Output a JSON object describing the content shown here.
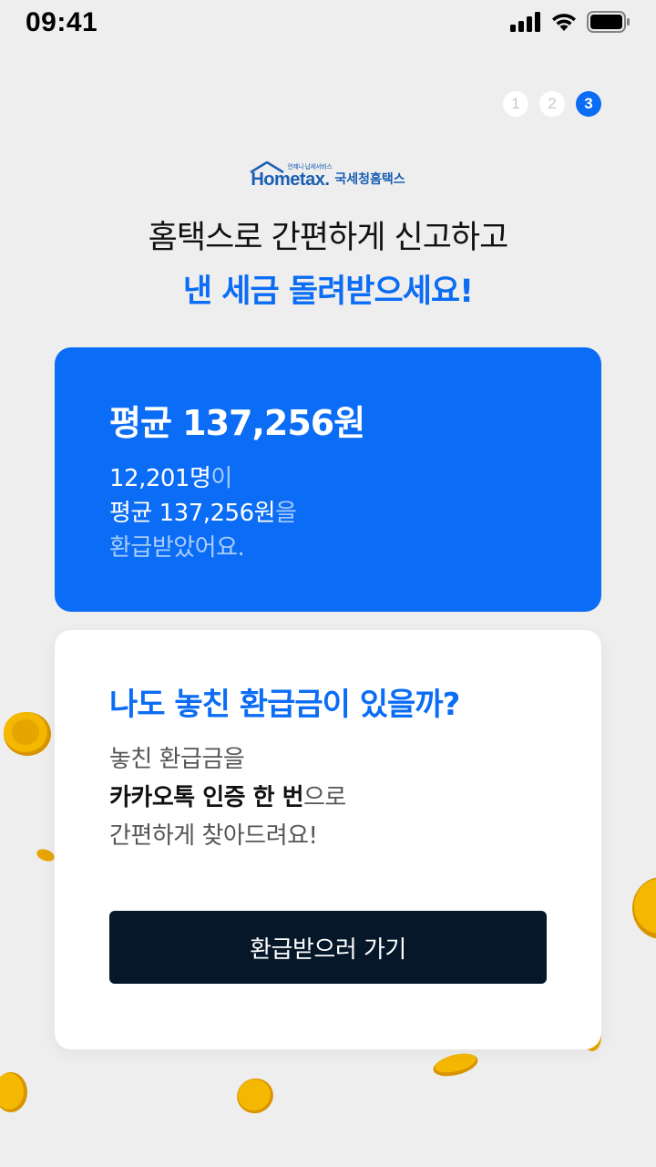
{
  "status_bar": {
    "time": "09:41",
    "icons": [
      "signal-icon",
      "wifi-icon",
      "battery-icon"
    ]
  },
  "steps": [
    "1",
    "2",
    "3"
  ],
  "active_step": "3",
  "logo": {
    "word": "Hometax.",
    "small_text": "언제나 납세서비스",
    "korean": "국세청홈택스"
  },
  "headline": {
    "line1": "홈택스로 간편하게 신고하고",
    "line2": "낸 세금 돌려받으세요!"
  },
  "refund_card": {
    "title": "평균 137,256원",
    "line1_main": "12,201명",
    "line1_soft": "이",
    "line2_main": "평균 137,256원",
    "line2_soft": "을",
    "line3_soft": "환급받았어요."
  },
  "missed_card": {
    "title": "나도 놓친 환급금이 있을까?",
    "line1": "놓친 환급금을",
    "line2_bold": "카카오톡 인증 한 번",
    "line2_rest": "으로",
    "line3": "간편하게 찾아드려요!",
    "cta_label": "환급받으러 가기"
  },
  "colors": {
    "accent": "#0b6cf5",
    "button": "#061729",
    "background": "#eeeeee",
    "coin": "#f5b800"
  }
}
